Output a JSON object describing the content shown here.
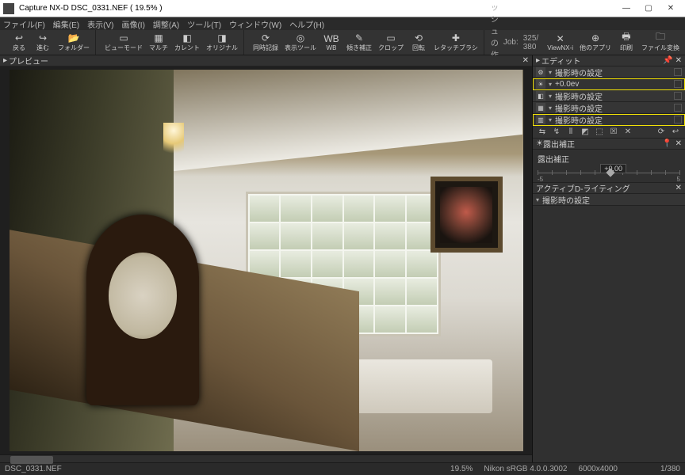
{
  "title": "Capture NX-D   DSC_0331.NEF ( 19.5% )",
  "menu": [
    "ファイル(F)",
    "編集(E)",
    "表示(V)",
    "画像(I)",
    "調整(A)",
    "ツール(T)",
    "ウィンドウ(W)",
    "ヘルプ(H)"
  ],
  "toolbar": {
    "nav": [
      {
        "icon": "↩",
        "label": "戻る"
      },
      {
        "icon": "↪",
        "label": "進む"
      },
      {
        "icon": "📂",
        "label": "フォルダー"
      }
    ],
    "view": [
      {
        "icon": "▭",
        "label": "ビューモード"
      },
      {
        "icon": "▦",
        "label": "マルチ"
      },
      {
        "icon": "◧",
        "label": "カレント"
      },
      {
        "icon": "◨",
        "label": "オリジナル"
      }
    ],
    "tools": [
      {
        "icon": "⟳",
        "label": "同時記録"
      },
      {
        "icon": "◎",
        "label": "表示ツール"
      },
      {
        "icon": "WB",
        "label": "WB"
      },
      {
        "icon": "✎",
        "label": "傾き補正"
      },
      {
        "icon": "▭",
        "label": "クロップ"
      },
      {
        "icon": "⟲",
        "label": "回転"
      },
      {
        "icon": "✚",
        "label": "レタッチブラシ"
      }
    ],
    "job_label": "キャッシュの作成を中断",
    "job_name": "Job:",
    "job_count": "325/ 380",
    "right": [
      {
        "icon": "✕",
        "label": "ViewNX-i"
      },
      {
        "icon": "⊕",
        "label": "他のアプリ"
      },
      {
        "icon": "🖶",
        "label": "印刷"
      },
      {
        "icon": "🗀",
        "label": "ファイル変換"
      }
    ]
  },
  "preview_tab": "プレビュー",
  "edit_tab": "エディット",
  "edit_rows": [
    {
      "icon": "⚙",
      "text": "撮影時の設定",
      "hl": false
    },
    {
      "icon": "☀",
      "text": "+0.0ev",
      "hl": true
    },
    {
      "icon": "◧",
      "text": "撮影時の設定",
      "hl": false
    },
    {
      "icon": "▦",
      "text": "撮影時の設定",
      "hl": false
    },
    {
      "icon": "▥",
      "text": "撮影時の設定",
      "hl": true
    }
  ],
  "iconrow": [
    "⇆",
    "↯",
    "⫴",
    "◩",
    "⬚",
    "☒",
    "✕"
  ],
  "iconrow_r": [
    "⟳",
    "↩"
  ],
  "exposure": {
    "title": "露出補正",
    "label": "露出補正",
    "min": "-5",
    "max": "5",
    "value": "+0.00"
  },
  "adl": {
    "title": "アクティブD-ライティング",
    "row": "撮影時の設定"
  },
  "status": {
    "file": "DSC_0331.NEF",
    "zoom": "19.5%",
    "profile": "Nikon sRGB 4.0.0.3002",
    "dims": "6000x4000",
    "index": "1/380"
  }
}
